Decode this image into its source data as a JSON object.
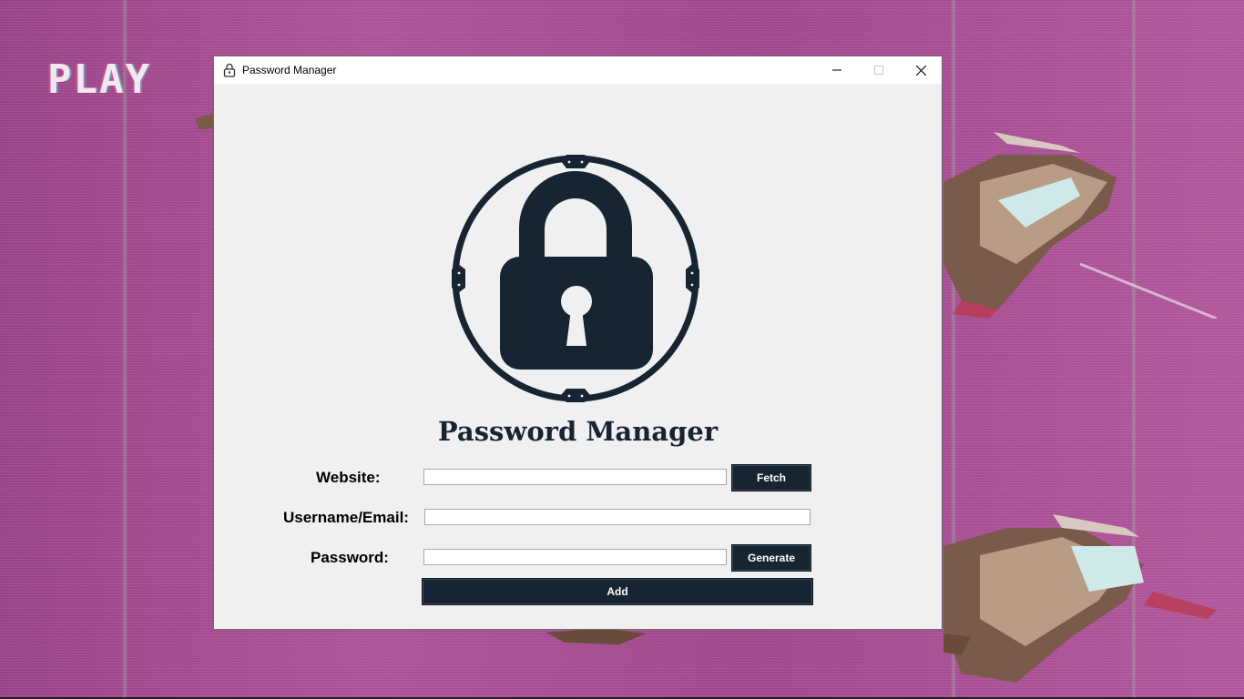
{
  "desktop": {
    "overlay_text": "PLAY"
  },
  "window": {
    "title": "Password Manager",
    "controls": {
      "minimize": "minimize",
      "maximize": "maximize",
      "close": "close"
    }
  },
  "app": {
    "heading": "Password Manager",
    "form": {
      "website_label": "Website:",
      "website_value": "",
      "fetch_label": "Fetch",
      "username_label": "Username/Email:",
      "username_value": "",
      "password_label": "Password:",
      "password_value": "",
      "generate_label": "Generate",
      "add_label": "Add"
    }
  },
  "colors": {
    "accent": "#172432",
    "window_bg": "#f0f0f0",
    "desktop_bg": "#a34a8f"
  }
}
